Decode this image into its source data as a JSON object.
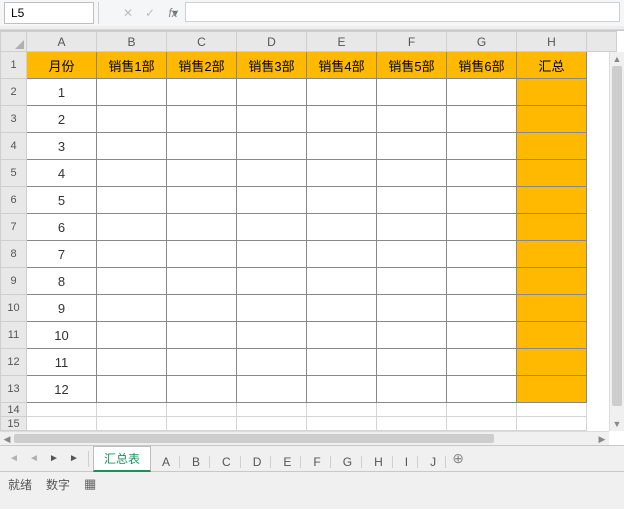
{
  "name_box": {
    "value": "L5"
  },
  "formula": {
    "value": ""
  },
  "fx_label": "fx",
  "cancel_glyph": "✕",
  "accept_glyph": "✓",
  "dropdown_glyph": "▾",
  "columns": [
    "A",
    "B",
    "C",
    "D",
    "E",
    "F",
    "G",
    "H"
  ],
  "header_row": [
    "月份",
    "销售1部",
    "销售2部",
    "销售3部",
    "销售4部",
    "销售5部",
    "销售6部",
    "汇总"
  ],
  "data_rows": [
    [
      "1",
      "",
      "",
      "",
      "",
      "",
      "",
      ""
    ],
    [
      "2",
      "",
      "",
      "",
      "",
      "",
      "",
      ""
    ],
    [
      "3",
      "",
      "",
      "",
      "",
      "",
      "",
      ""
    ],
    [
      "4",
      "",
      "",
      "",
      "",
      "",
      "",
      ""
    ],
    [
      "5",
      "",
      "",
      "",
      "",
      "",
      "",
      ""
    ],
    [
      "6",
      "",
      "",
      "",
      "",
      "",
      "",
      ""
    ],
    [
      "7",
      "",
      "",
      "",
      "",
      "",
      "",
      ""
    ],
    [
      "8",
      "",
      "",
      "",
      "",
      "",
      "",
      ""
    ],
    [
      "9",
      "",
      "",
      "",
      "",
      "",
      "",
      ""
    ],
    [
      "10",
      "",
      "",
      "",
      "",
      "",
      "",
      ""
    ],
    [
      "11",
      "",
      "",
      "",
      "",
      "",
      "",
      ""
    ],
    [
      "12",
      "",
      "",
      "",
      "",
      "",
      "",
      ""
    ]
  ],
  "extra_rows": [
    14,
    15
  ],
  "sheet_tabs": {
    "active": "汇总表",
    "list": [
      "汇总表",
      "A",
      "B",
      "C",
      "D",
      "E",
      "F",
      "G",
      "H",
      "I",
      "J"
    ]
  },
  "status": {
    "mode": "就绪",
    "numlock": "数字"
  },
  "nav": {
    "first": "◄",
    "prev": "◄",
    "next": "►",
    "last": "►"
  },
  "add_sheet_glyph": "⊕"
}
